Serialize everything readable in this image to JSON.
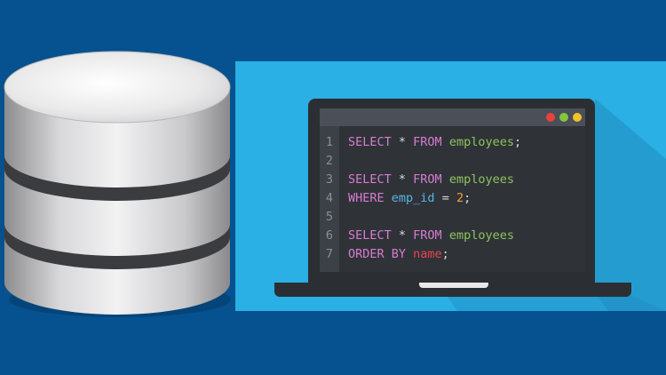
{
  "editor": {
    "lines": [
      {
        "n": "1",
        "parts": [
          {
            "t": "SELECT ",
            "c": "kw"
          },
          {
            "t": "* ",
            "c": "pl"
          },
          {
            "t": "FROM ",
            "c": "kw"
          },
          {
            "t": "employees",
            "c": "tb"
          },
          {
            "t": ";",
            "c": "pl"
          }
        ]
      },
      {
        "n": "2",
        "parts": []
      },
      {
        "n": "3",
        "parts": [
          {
            "t": "SELECT ",
            "c": "kw"
          },
          {
            "t": "* ",
            "c": "pl"
          },
          {
            "t": "FROM ",
            "c": "kw"
          },
          {
            "t": "employees",
            "c": "tb"
          }
        ]
      },
      {
        "n": "4",
        "parts": [
          {
            "t": "WHERE ",
            "c": "kw"
          },
          {
            "t": "emp_id",
            "c": "col"
          },
          {
            "t": " = ",
            "c": "pl"
          },
          {
            "t": "2",
            "c": "num"
          },
          {
            "t": ";",
            "c": "pl"
          }
        ]
      },
      {
        "n": "5",
        "parts": []
      },
      {
        "n": "6",
        "parts": [
          {
            "t": "SELECT ",
            "c": "kw"
          },
          {
            "t": "* ",
            "c": "pl"
          },
          {
            "t": "FROM ",
            "c": "kw"
          },
          {
            "t": "employees",
            "c": "tb"
          }
        ]
      },
      {
        "n": "7",
        "parts": [
          {
            "t": "ORDER BY ",
            "c": "kw"
          },
          {
            "t": "name",
            "c": "wd"
          },
          {
            "t": ";",
            "c": "pl"
          }
        ]
      }
    ]
  },
  "colors": {
    "background": "#06518f",
    "panel": "#2ab0e4",
    "laptop": "#2b2f34",
    "keyword": "#d77bd0",
    "table": "#8fc35c",
    "column": "#55b6e6",
    "number": "#f0a032",
    "name": "#e8454c"
  },
  "icons": {
    "database": "database-cylinder-icon",
    "laptop": "laptop-icon"
  }
}
